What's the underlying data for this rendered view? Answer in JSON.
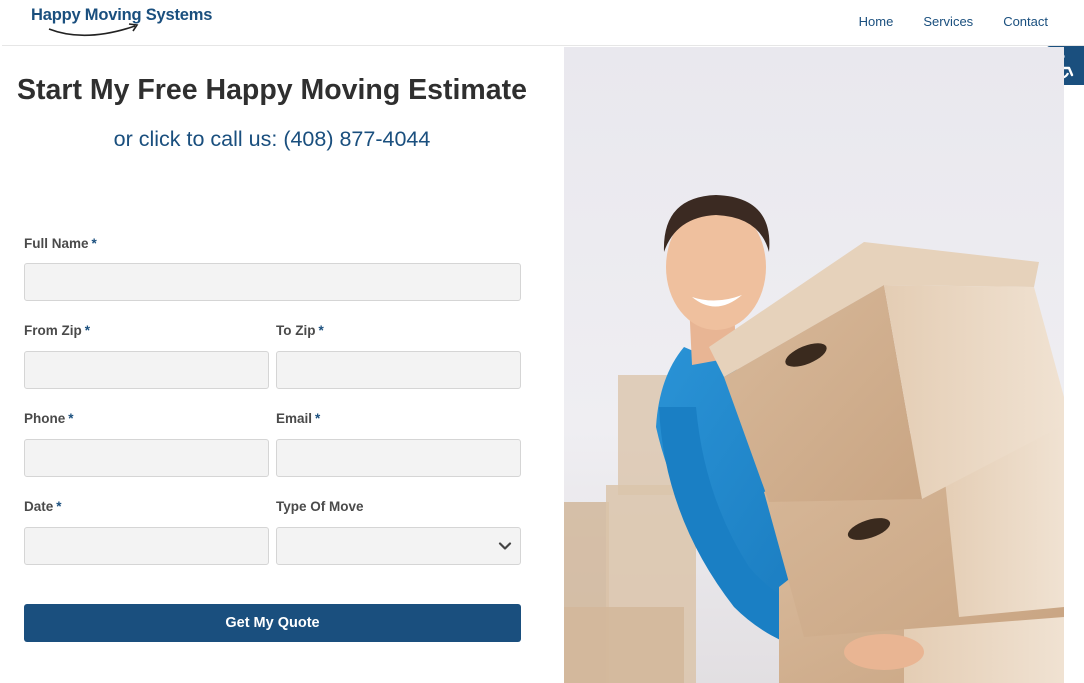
{
  "header": {
    "logo_text": "Happy Moving Systems",
    "nav": [
      {
        "label": "Home"
      },
      {
        "label": "Services"
      },
      {
        "label": "Contact"
      }
    ]
  },
  "accessibility": {
    "icon": "accessibility-icon"
  },
  "form": {
    "title": "Start My Free Happy Moving Estimate",
    "call_text": "or click to call us: (408) 877-4044",
    "required_mark": "*",
    "fields": {
      "full_name": {
        "label": "Full Name",
        "value": "",
        "placeholder": ""
      },
      "from_zip": {
        "label": "From Zip",
        "value": "",
        "placeholder": ""
      },
      "to_zip": {
        "label": "To Zip",
        "value": "",
        "placeholder": ""
      },
      "phone": {
        "label": "Phone",
        "value": "",
        "placeholder": ""
      },
      "email": {
        "label": "Email",
        "value": "",
        "placeholder": ""
      },
      "date": {
        "label": "Date",
        "value": "",
        "placeholder": ""
      },
      "type_of_move": {
        "label": "Type Of Move",
        "selected": ""
      }
    },
    "submit_label": "Get My Quote"
  },
  "colors": {
    "brand": "#1a4f7e",
    "field_bg": "#f3f3f3",
    "title": "#2f2f2f"
  }
}
